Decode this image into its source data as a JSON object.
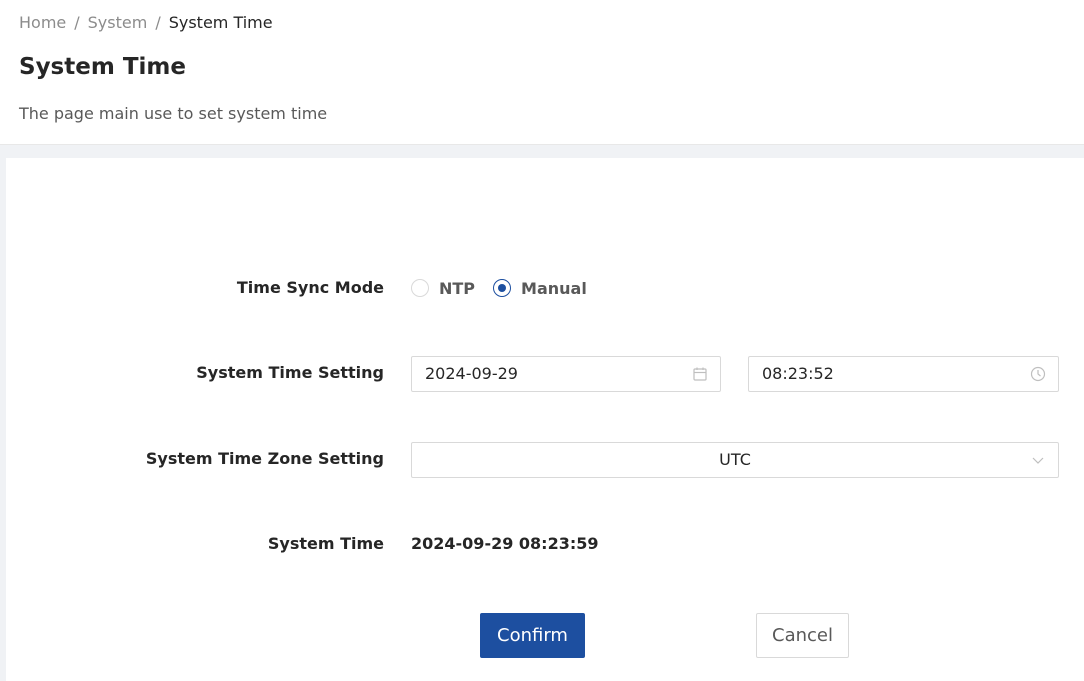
{
  "breadcrumb": {
    "items": [
      "Home",
      "System",
      "System Time"
    ],
    "separator": "/"
  },
  "page": {
    "title": "System Time",
    "description": "The page main use to set system time"
  },
  "form": {
    "sync_mode": {
      "label": "Time Sync Mode",
      "options": [
        "NTP",
        "Manual"
      ],
      "selected": "Manual"
    },
    "time_setting": {
      "label": "System Time Setting",
      "date_value": "2024-09-29",
      "time_value": "08:23:52",
      "date_icon": "calendar-icon",
      "time_icon": "clock-icon"
    },
    "timezone": {
      "label": "System Time Zone Setting",
      "value": "UTC",
      "icon": "chevron-down-icon"
    },
    "system_time": {
      "label": "System Time",
      "value": "2024-09-29 08:23:59"
    }
  },
  "actions": {
    "confirm_label": "Confirm",
    "cancel_label": "Cancel"
  },
  "colors": {
    "primary": "#1d4fa0",
    "background": "#f0f2f5",
    "border": "#d9d9d9"
  }
}
